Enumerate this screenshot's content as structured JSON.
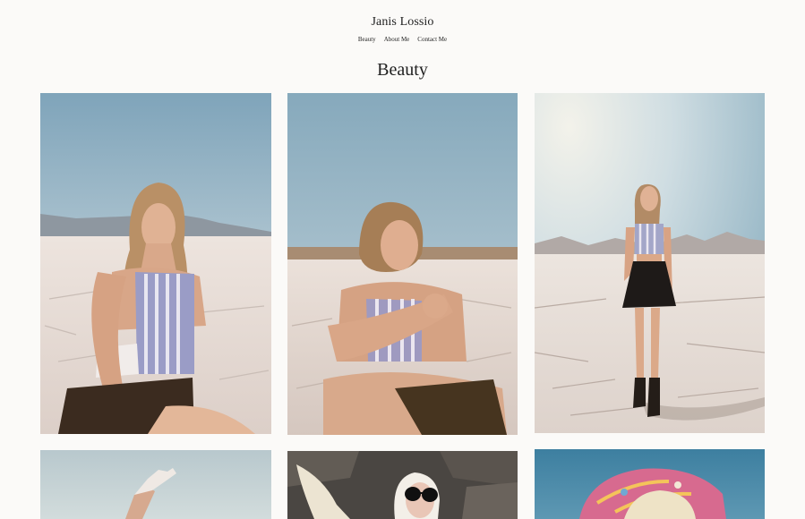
{
  "site": {
    "title": "Janis Lossio"
  },
  "nav": {
    "items": [
      "Beauty",
      "About Me",
      "Contact Me"
    ]
  },
  "page": {
    "title": "Beauty"
  },
  "gallery": {
    "photos": [
      {
        "subject": "woman seated on salt flat, pinstriped halter top, brown shorts"
      },
      {
        "subject": "woman crouching, arms crossed, hand at chin, salt flat"
      },
      {
        "subject": "woman standing on cracked salt flat, black skirt, boots"
      },
      {
        "subject": "raised arm with white glove against blue sky"
      },
      {
        "subject": "platinum blonde woman in sunglasses among rocks"
      },
      {
        "subject": "woman with colorful patterned headscarf against blue sky"
      }
    ]
  },
  "colors": {
    "background": "#fbfaf8",
    "text": "#1f1f1f",
    "sky": "#8fb3c6",
    "salt_flat": "#e6dcd6"
  }
}
